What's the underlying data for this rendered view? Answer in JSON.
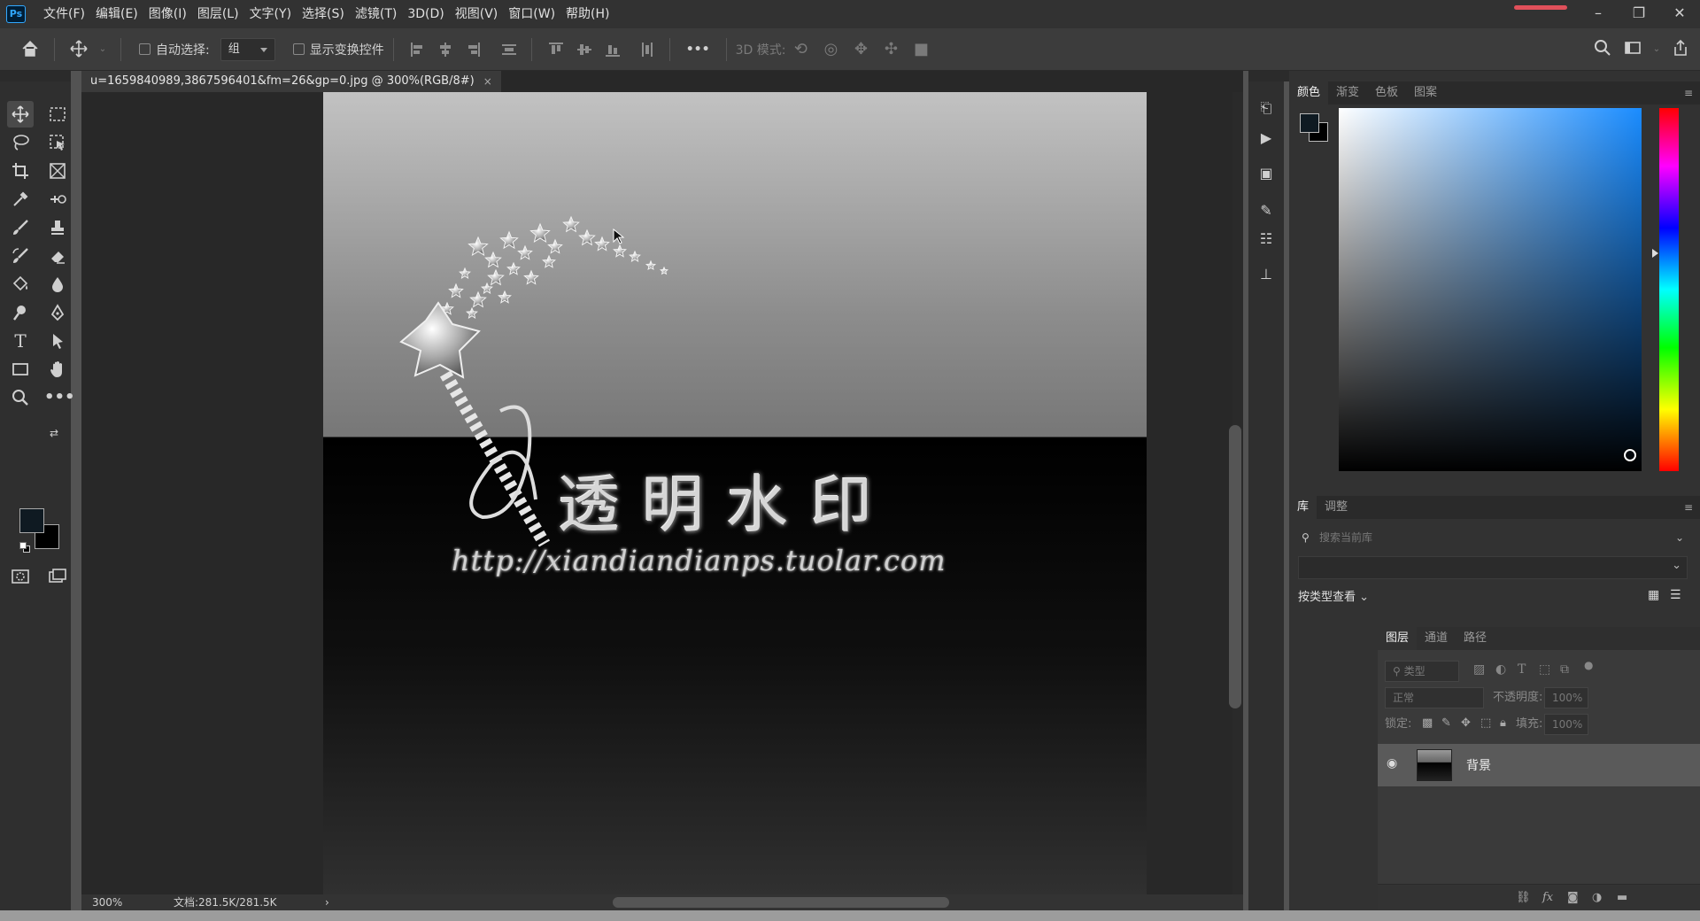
{
  "app": {
    "logo": "Ps"
  },
  "menu": [
    "文件(F)",
    "编辑(E)",
    "图像(I)",
    "图层(L)",
    "文字(Y)",
    "选择(S)",
    "滤镜(T)",
    "3D(D)",
    "视图(V)",
    "窗口(W)",
    "帮助(H)"
  ],
  "window_controls": {
    "minimize": "–",
    "restore": "❐",
    "close": "✕"
  },
  "options_bar": {
    "auto_select_label": "自动选择:",
    "auto_select_value": "组",
    "show_transform_label": "显示变换控件",
    "more": "•••",
    "mode_3d_label": "3D 模式:"
  },
  "document": {
    "tab_title": "u=1659840989,3867596401&fm=26&gp=0.jpg @ 300%(RGB/8#)",
    "close": "×",
    "watermark_title": "透明水印",
    "watermark_url": "http://xiandiandianps.tuolar.com"
  },
  "status": {
    "zoom": "300%",
    "doc_info": "文档:281.5K/281.5K",
    "arrow": "›"
  },
  "color_panel": {
    "tabs": [
      "颜色",
      "渐变",
      "色板",
      "图案"
    ],
    "active_tab": "颜色",
    "foreground": "#0f1a22",
    "background": "#000000"
  },
  "library_panel": {
    "tabs": [
      "库",
      "调整"
    ],
    "search_placeholder": "搜索当前库",
    "view_label": "按类型查看"
  },
  "layers_panel": {
    "tabs": [
      "图层",
      "通道",
      "路径"
    ],
    "filter_placeholder": "类型",
    "blend_mode": "正常",
    "opacity_label": "不透明度:",
    "opacity_value": "100%",
    "lock_label": "锁定:",
    "fill_label": "填充:",
    "fill_value": "100%",
    "layers": [
      {
        "name": "背景",
        "visible": true
      }
    ]
  },
  "icons": [
    "home-icon",
    "move-icon",
    "marquee-icon",
    "lasso-icon",
    "crop-icon",
    "eyedropper-icon",
    "brush-icon",
    "stamp-icon",
    "eraser-icon",
    "bucket-icon",
    "dodge-icon",
    "pen-icon",
    "type-icon",
    "path-select-icon",
    "rectangle-icon",
    "hand-icon",
    "zoom-icon",
    "more-icon",
    "search-icon",
    "workspace-icon",
    "share-icon"
  ]
}
